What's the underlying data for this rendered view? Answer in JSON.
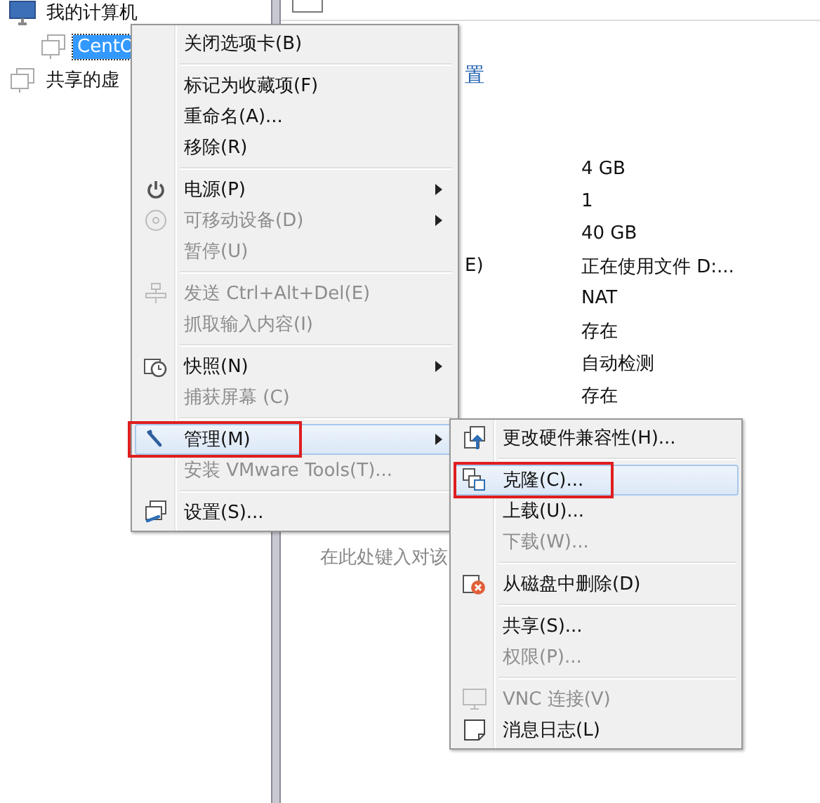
{
  "sidebar": {
    "items": [
      {
        "label": "我的计算机",
        "selected": false,
        "children": [
          {
            "label": "CentO",
            "selected": true
          }
        ]
      },
      {
        "label": "共享的虚",
        "selected": false
      }
    ]
  },
  "details": {
    "link": "置",
    "rows": [
      {
        "label": "",
        "value": "4 GB"
      },
      {
        "label": "",
        "value": "1"
      },
      {
        "label": "",
        "value": "40 GB"
      },
      {
        "label": "E)",
        "value": "正在使用文件 D:..."
      },
      {
        "label": "",
        "value": "NAT"
      },
      {
        "label": "",
        "value": "存在"
      },
      {
        "label": "",
        "value": "自动检测"
      },
      {
        "label": "",
        "value": "存在"
      }
    ],
    "note": "在此处键入对该"
  },
  "context_menu": {
    "items": [
      {
        "kind": "item",
        "label": "关闭选项卡(B)",
        "disabled": false,
        "submenu": false,
        "selected": false,
        "annotated": false
      },
      {
        "kind": "separator"
      },
      {
        "kind": "item",
        "label": "标记为收藏项(F)",
        "disabled": false,
        "submenu": false,
        "selected": false,
        "annotated": false
      },
      {
        "kind": "item",
        "label": "重命名(A)...",
        "disabled": false,
        "submenu": false,
        "selected": false,
        "annotated": false
      },
      {
        "kind": "item",
        "label": "移除(R)",
        "disabled": false,
        "submenu": false,
        "selected": false,
        "annotated": false
      },
      {
        "kind": "separator"
      },
      {
        "kind": "item",
        "label": "电源(P)",
        "disabled": false,
        "submenu": true,
        "selected": false,
        "annotated": false
      },
      {
        "kind": "item",
        "label": "可移动设备(D)",
        "disabled": true,
        "submenu": true,
        "selected": false,
        "annotated": false
      },
      {
        "kind": "item",
        "label": "暂停(U)",
        "disabled": true,
        "submenu": false,
        "selected": false,
        "annotated": false
      },
      {
        "kind": "separator"
      },
      {
        "kind": "item",
        "label": "发送 Ctrl+Alt+Del(E)",
        "disabled": true,
        "submenu": false,
        "selected": false,
        "annotated": false
      },
      {
        "kind": "item",
        "label": "抓取输入内容(I)",
        "disabled": true,
        "submenu": false,
        "selected": false,
        "annotated": false
      },
      {
        "kind": "separator"
      },
      {
        "kind": "item",
        "label": "快照(N)",
        "disabled": false,
        "submenu": true,
        "selected": false,
        "annotated": false
      },
      {
        "kind": "item",
        "label": "捕获屏幕 (C)",
        "disabled": true,
        "submenu": false,
        "selected": false,
        "annotated": false
      },
      {
        "kind": "separator"
      },
      {
        "kind": "item",
        "label": "管理(M)",
        "disabled": false,
        "submenu": true,
        "selected": true,
        "annotated": true
      },
      {
        "kind": "item",
        "label": "安装 VMware Tools(T)...",
        "disabled": true,
        "submenu": false,
        "selected": false,
        "annotated": false
      },
      {
        "kind": "separator"
      },
      {
        "kind": "item",
        "label": "设置(S)...",
        "disabled": false,
        "submenu": false,
        "selected": false,
        "annotated": false
      }
    ]
  },
  "submenu": {
    "items": [
      {
        "kind": "item",
        "label": "更改硬件兼容性(H)...",
        "disabled": false,
        "submenu": false,
        "selected": false,
        "annotated": false
      },
      {
        "kind": "separator"
      },
      {
        "kind": "item",
        "label": "克隆(C)...",
        "disabled": false,
        "submenu": false,
        "selected": true,
        "annotated": true
      },
      {
        "kind": "item",
        "label": "上载(U)...",
        "disabled": false,
        "submenu": false,
        "selected": false,
        "annotated": false
      },
      {
        "kind": "item",
        "label": "下载(W)...",
        "disabled": true,
        "submenu": false,
        "selected": false,
        "annotated": false
      },
      {
        "kind": "separator"
      },
      {
        "kind": "item",
        "label": "从磁盘中删除(D)",
        "disabled": false,
        "submenu": false,
        "selected": false,
        "annotated": false
      },
      {
        "kind": "separator"
      },
      {
        "kind": "item",
        "label": "共享(S)...",
        "disabled": false,
        "submenu": false,
        "selected": false,
        "annotated": false
      },
      {
        "kind": "item",
        "label": "权限(P)...",
        "disabled": true,
        "submenu": false,
        "selected": false,
        "annotated": false
      },
      {
        "kind": "separator"
      },
      {
        "kind": "item",
        "label": "VNC 连接(V)",
        "disabled": true,
        "submenu": false,
        "selected": false,
        "annotated": false
      },
      {
        "kind": "item",
        "label": "消息日志(L)",
        "disabled": false,
        "submenu": false,
        "selected": false,
        "annotated": false
      }
    ]
  }
}
